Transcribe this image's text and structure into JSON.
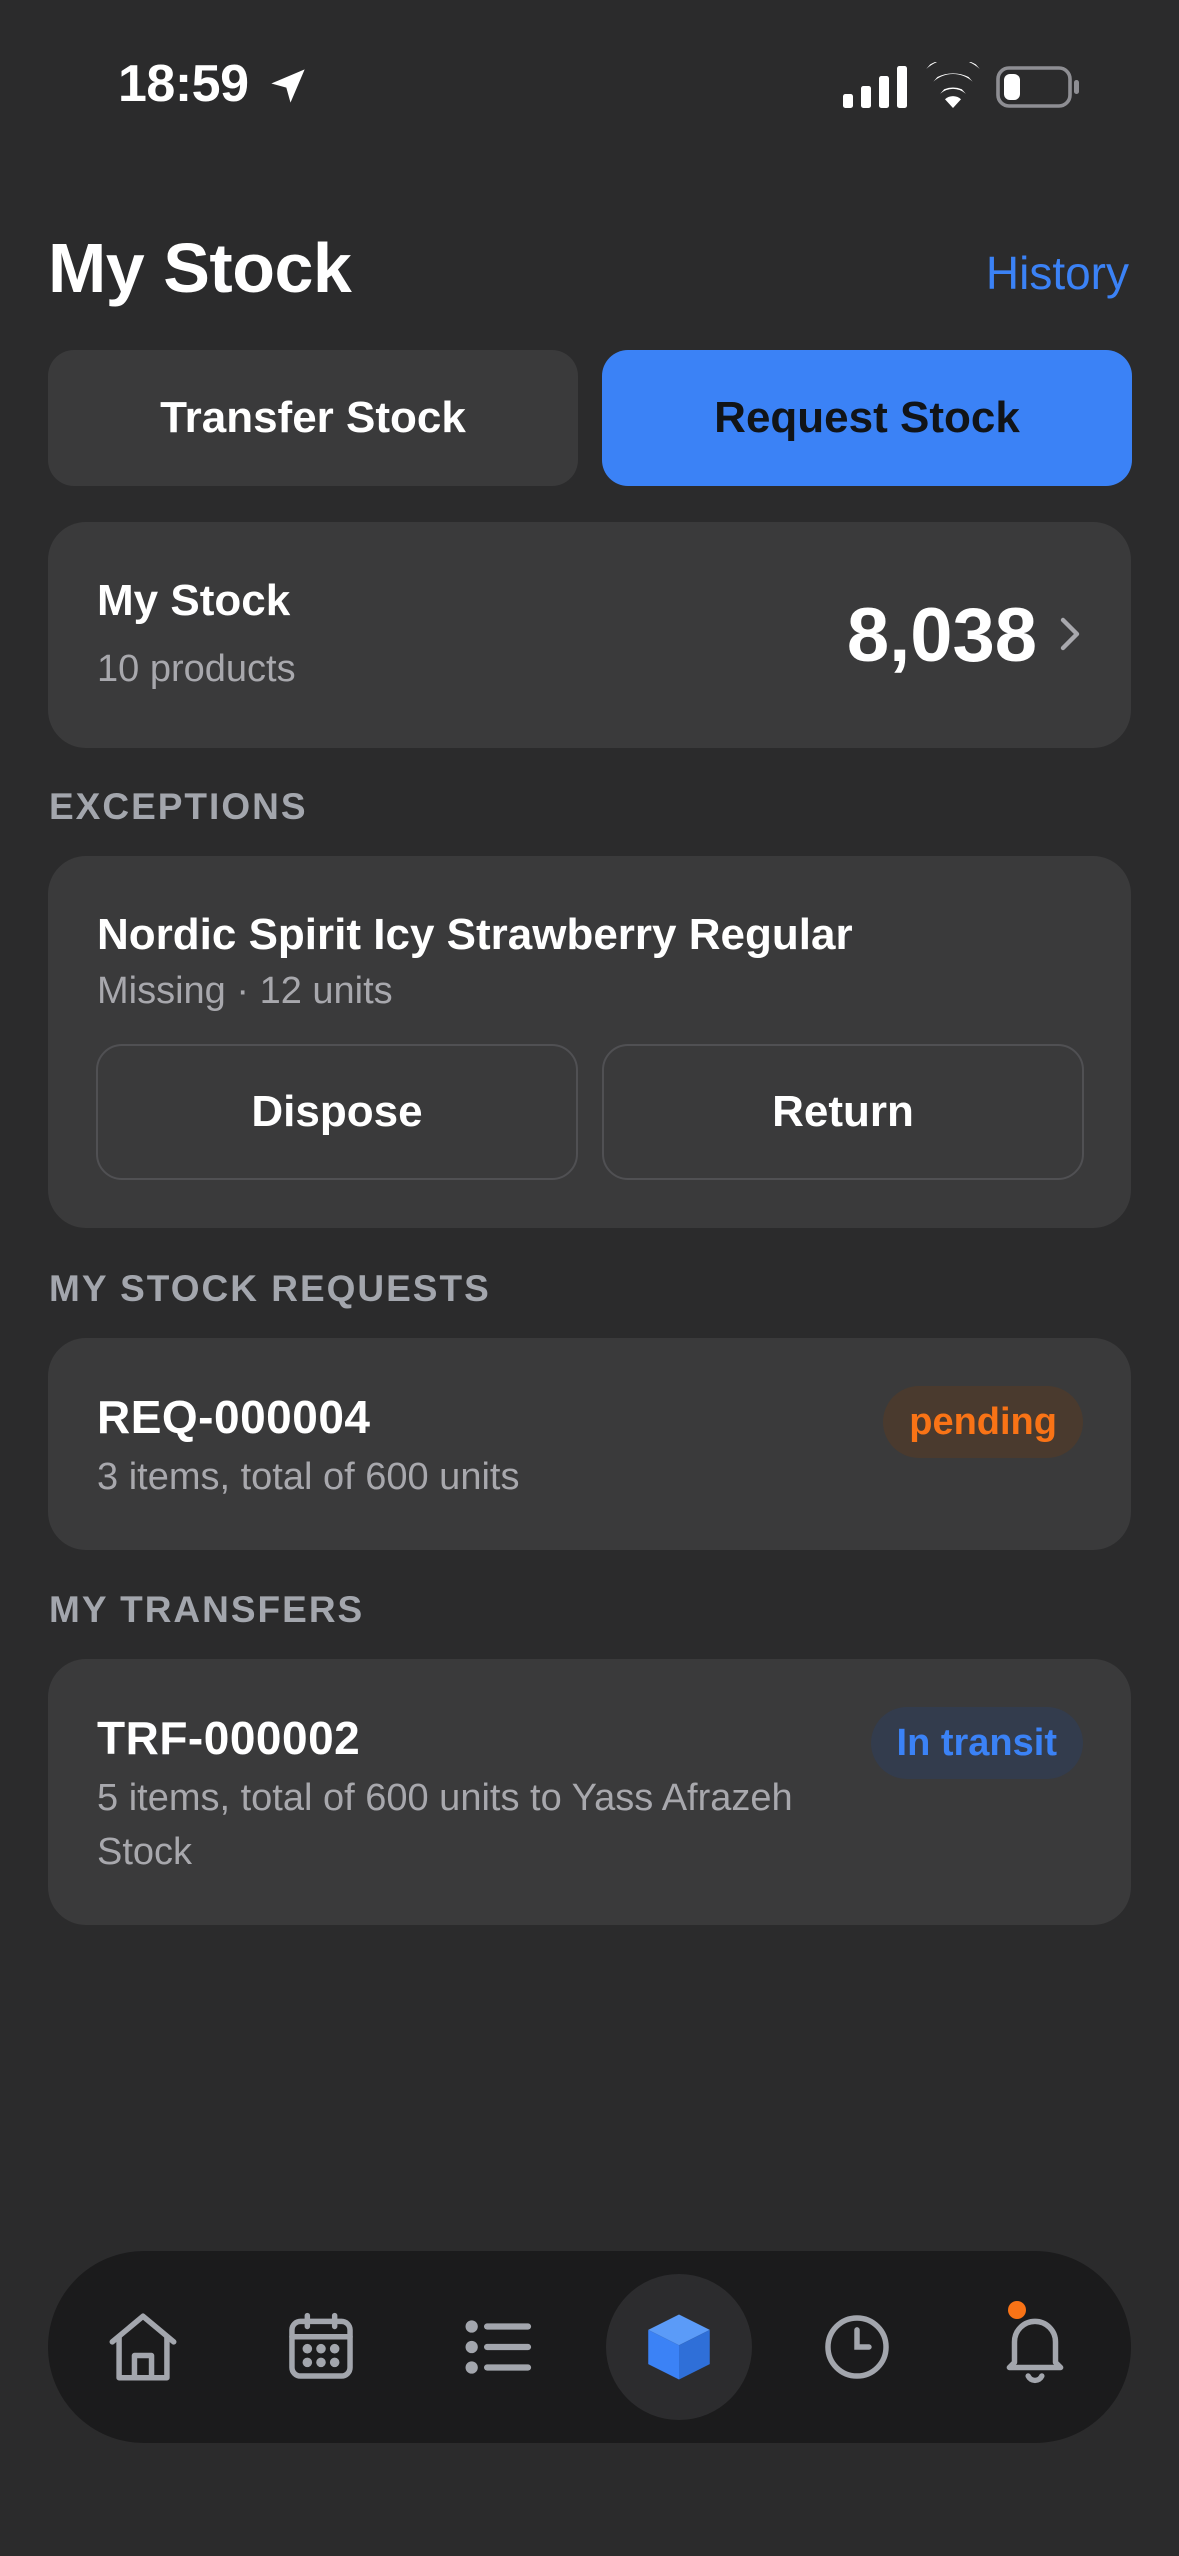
{
  "status_bar": {
    "time": "18:59"
  },
  "header": {
    "title": "My Stock",
    "history_label": "History"
  },
  "actions": {
    "transfer_label": "Transfer Stock",
    "request_label": "Request Stock"
  },
  "stock_summary": {
    "title": "My Stock",
    "subtitle": "10 products",
    "total": "8,038"
  },
  "exceptions": {
    "section_label": "EXCEPTIONS",
    "item": {
      "title": "Nordic Spirit Icy Strawberry Regular",
      "subtitle": "Missing · 12 units",
      "dispose_label": "Dispose",
      "return_label": "Return"
    }
  },
  "stock_requests": {
    "section_label": "MY STOCK REQUESTS",
    "item": {
      "id": "REQ-000004",
      "subtitle": "3 items, total of 600 units",
      "status": "pending"
    }
  },
  "transfers": {
    "section_label": "MY TRANSFERS",
    "item": {
      "id": "TRF-000002",
      "subtitle": "5 items, total of 600 units to Yass Afrazeh Stock",
      "status": "In transit"
    }
  },
  "bottom_nav": {
    "items": [
      {
        "icon": "home-icon"
      },
      {
        "icon": "calendar-icon"
      },
      {
        "icon": "list-icon"
      },
      {
        "icon": "box-icon",
        "active": true
      },
      {
        "icon": "clock-icon"
      },
      {
        "icon": "bell-icon",
        "has_notification": true
      }
    ]
  },
  "colors": {
    "accent": "#3b82f6",
    "pending": "#f97316",
    "background": "#2b2b2c",
    "card": "#3a3a3b"
  }
}
